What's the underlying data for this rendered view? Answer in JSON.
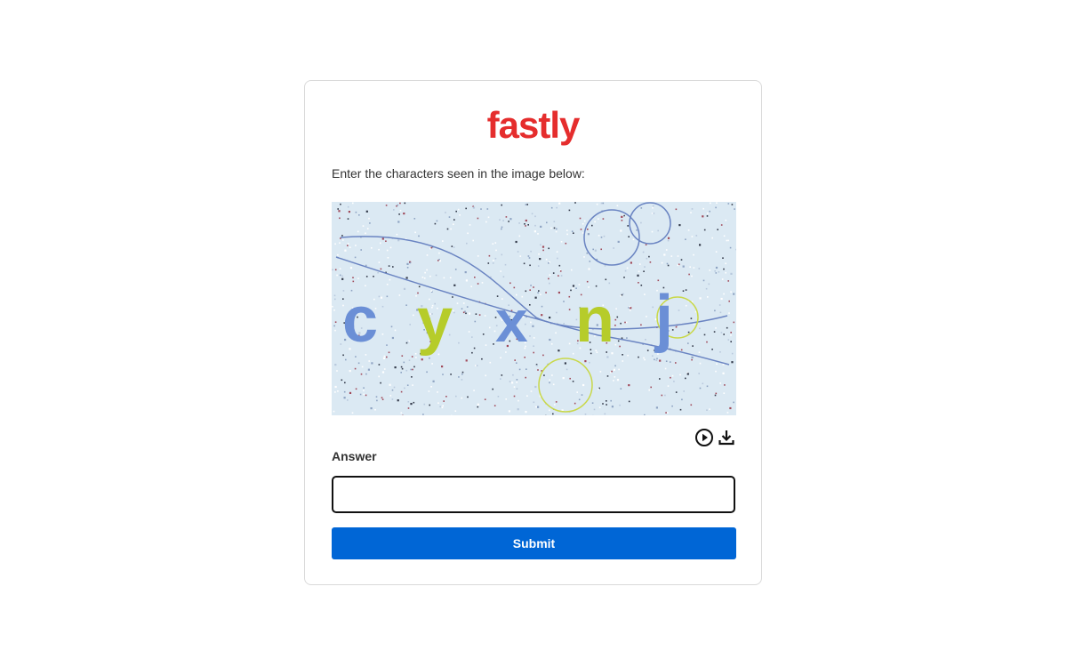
{
  "brand": {
    "logo_text": "fastly",
    "logo_color": "#e52d2d"
  },
  "captcha": {
    "prompt": "Enter the characters seen in the image below:",
    "characters": [
      "c",
      "y",
      "x",
      "n",
      "j"
    ],
    "character_colors": [
      "#6b8fd6",
      "#b6cc2a",
      "#6b8fd6",
      "#b6cc2a",
      "#6b8fd6"
    ],
    "background_color": "#dbe9f3",
    "play_icon": "play-audio-icon",
    "download_icon": "download-icon"
  },
  "form": {
    "answer_label": "Answer",
    "answer_value": "",
    "answer_placeholder": "",
    "submit_label": "Submit"
  },
  "colors": {
    "accent": "#0066d6",
    "input_border": "#111111",
    "card_border": "#d9d9d9"
  }
}
